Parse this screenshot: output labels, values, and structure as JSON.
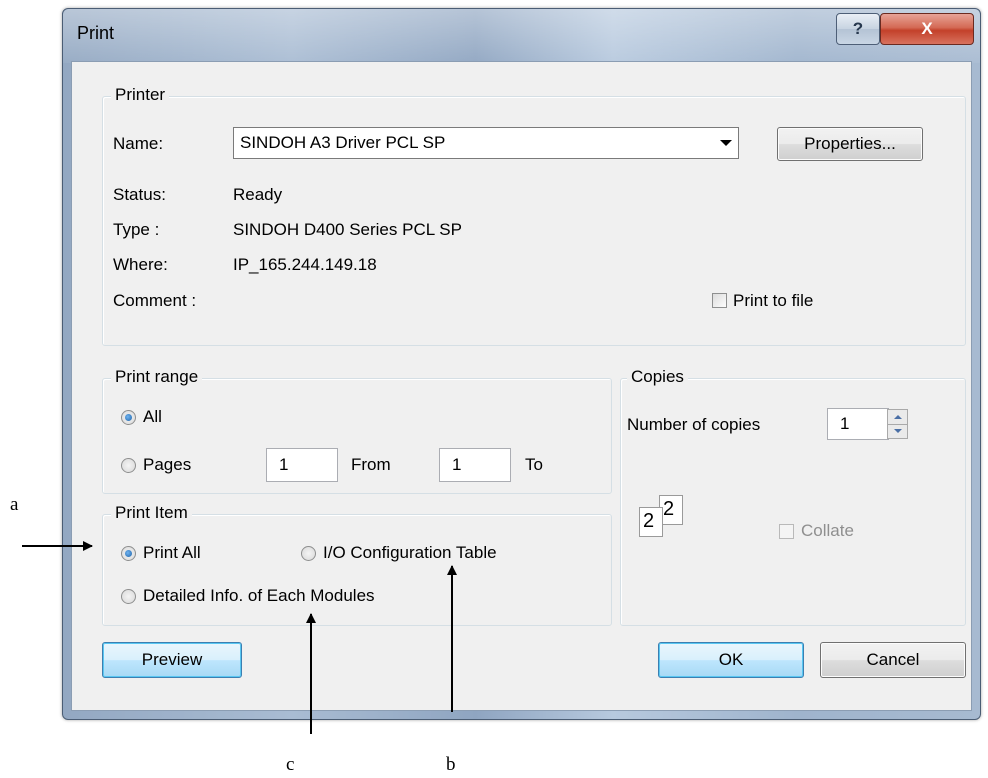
{
  "window": {
    "title": "Print",
    "help_glyph": "?",
    "close_glyph": "X"
  },
  "printer": {
    "group_label": "Printer",
    "name_label": "Name:",
    "name_value": "SINDOH A3 Driver PCL SP",
    "properties_button": "Properties...",
    "status_label": "Status:",
    "status_value": "Ready",
    "type_label": "Type :",
    "type_value": "SINDOH D400 Series PCL SP",
    "where_label": "Where:",
    "where_value": "IP_165.244.149.18",
    "comment_label": "Comment :",
    "print_to_file_label": "Print to file",
    "print_to_file_checked": false
  },
  "print_range": {
    "group_label": "Print range",
    "all_label": "All",
    "pages_label": "Pages",
    "from_value": "1",
    "from_label": "From",
    "to_value": "1",
    "to_label": "To",
    "selected": "all"
  },
  "copies": {
    "group_label": "Copies",
    "number_label": "Number of copies",
    "number_value": "1",
    "collate_label": "Collate",
    "collate_enabled": false,
    "icon_page_front": "2",
    "icon_page_back": "2"
  },
  "print_item": {
    "group_label": "Print Item",
    "print_all_label": "Print All",
    "io_table_label": "I/O Configuration Table",
    "detailed_label": "Detailed Info. of Each Modules",
    "selected": "print_all"
  },
  "buttons": {
    "preview": "Preview",
    "ok": "OK",
    "cancel": "Cancel"
  },
  "annotations": {
    "a": "a",
    "b": "b",
    "c": "c"
  }
}
